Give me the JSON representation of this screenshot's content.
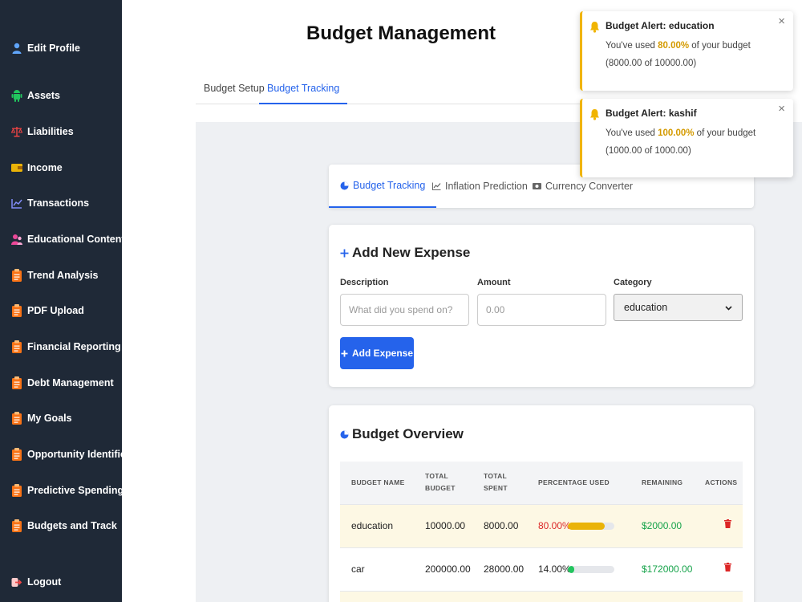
{
  "sidebar": {
    "items": [
      {
        "label": "Edit Profile",
        "icon": "user-icon"
      },
      {
        "label": "Assets",
        "icon": "android-icon"
      },
      {
        "label": "Liabilities",
        "icon": "scale-icon"
      },
      {
        "label": "Income",
        "icon": "wallet-icon"
      },
      {
        "label": "Transactions",
        "icon": "chart-line-icon"
      },
      {
        "label": "Educational Content",
        "icon": "user-group-icon"
      },
      {
        "label": "Trend Analysis",
        "icon": "clipboard-icon"
      },
      {
        "label": "PDF Upload",
        "icon": "clipboard-icon"
      },
      {
        "label": "Financial Reporting",
        "icon": "clipboard-icon"
      },
      {
        "label": "Debt Management",
        "icon": "clipboard-icon"
      },
      {
        "label": "My Goals",
        "icon": "clipboard-icon"
      },
      {
        "label": "Opportunity Identifier",
        "icon": "clipboard-icon"
      },
      {
        "label": "Predictive Spending",
        "icon": "clipboard-icon"
      },
      {
        "label": "Budgets and Track",
        "icon": "clipboard-icon"
      }
    ],
    "logout": "Logout"
  },
  "header": {
    "title": "Budget Management",
    "tabs": [
      "Budget Setup",
      "Budget Tracking"
    ],
    "active_tab": "Budget Tracking"
  },
  "inner_tabs": [
    "Budget Tracking",
    "Inflation Prediction",
    "Currency Converter"
  ],
  "expense_form": {
    "title": "Add New Expense",
    "description_label": "Description",
    "description_placeholder": "What did you spend on?",
    "amount_label": "Amount",
    "amount_placeholder": "0.00",
    "category_label": "Category",
    "category_value": "education",
    "submit_label": "Add Expense"
  },
  "overview": {
    "title": "Budget Overview",
    "headers": {
      "name": [
        "BUDGET NAME"
      ],
      "total": [
        "TOTAL",
        "BUDGET"
      ],
      "spent": [
        "TOTAL",
        "SPENT"
      ],
      "pct": [
        "PERCENTAGE USED"
      ],
      "remaining": [
        "REMAINING"
      ],
      "actions": [
        "ACTIONS"
      ]
    },
    "rows": [
      {
        "name": "education",
        "total": "10000.00",
        "spent": "8000.00",
        "pct": "80.00%",
        "pct_value": 0.8,
        "remaining": "$2000.00"
      },
      {
        "name": "car",
        "total": "200000.00",
        "spent": "28000.00",
        "pct": "14.00%",
        "pct_value": 0.14,
        "remaining": "$172000.00"
      }
    ]
  },
  "alerts": [
    {
      "title": "Budget Alert: education",
      "pre": "You've used ",
      "pct": "80.00%",
      "post": " of your budget (8000.00 of 10000.00)"
    },
    {
      "title": "Budget Alert: kashif",
      "pre": "You've used ",
      "pct": "100.00%",
      "post": " of your budget (1000.00 of 1000.00)"
    }
  ],
  "colors": {
    "sidebar_bg": "#1f2937",
    "accent": "#2563eb",
    "warning": "#f0b400",
    "danger": "#dc2626",
    "success": "#16a34a",
    "warn_row": "#fdf8e4"
  }
}
